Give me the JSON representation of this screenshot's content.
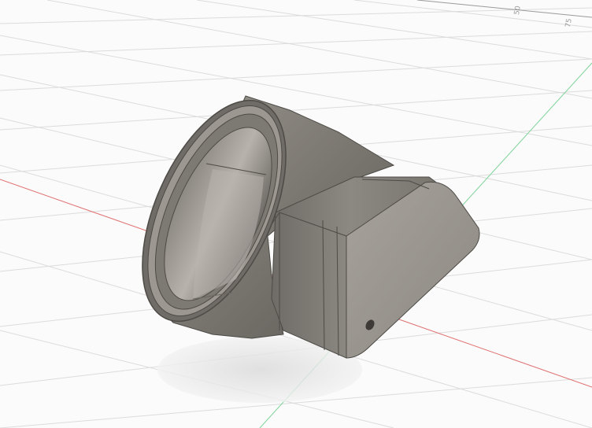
{
  "viewport": {
    "background": "#fbfbfb",
    "grid_color": "#dcdcdc",
    "x_axis_color": "#e07070",
    "y_axis_color": "#7fd39a",
    "model_color": "#7a7670"
  },
  "grid_labels": [
    "50",
    "75"
  ]
}
